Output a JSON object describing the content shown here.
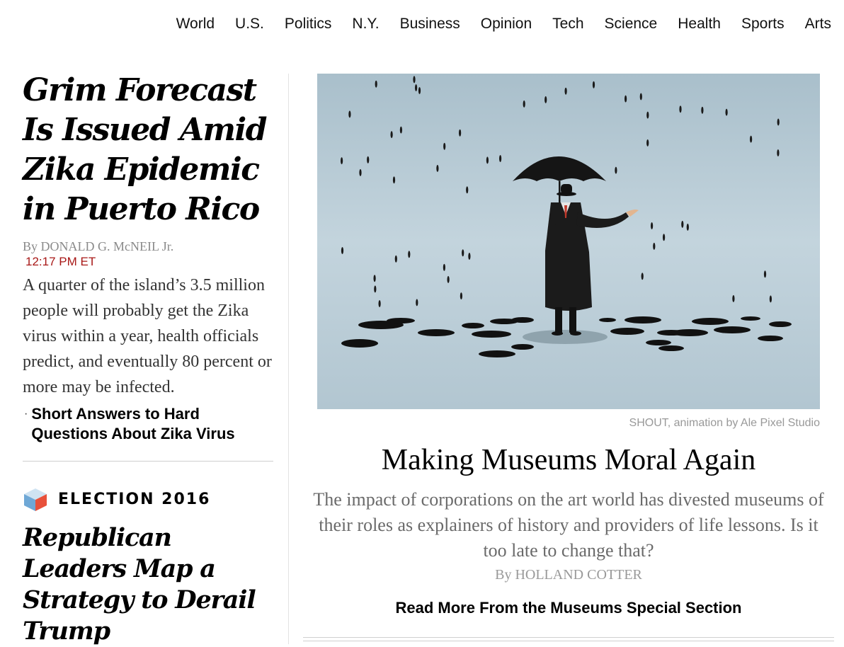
{
  "nav": {
    "items": [
      "World",
      "U.S.",
      "Politics",
      "N.Y.",
      "Business",
      "Opinion",
      "Tech",
      "Science",
      "Health",
      "Sports",
      "Arts"
    ]
  },
  "lead_story": {
    "headline": "Grim Forecast Is Issued Amid Zika Epidemic in Puerto Rico",
    "byline": "By DONALD G. McNEIL Jr.",
    "timestamp": "12:17 PM ET",
    "summary": "A quarter of the island’s 3.5 million people will probably get the Zika virus within a year, health officials predict, and eventually 80 percent or more may be infected.",
    "related_link": "Short Answers to Hard Questions About Zika Virus"
  },
  "election_story": {
    "kicker": "ELECTION 2016",
    "kicker_icon": "cube-icon",
    "headline": "Republican Leaders Map a Strategy to Derail Trump"
  },
  "feature_story": {
    "image_credit": "SHOUT, animation by Ale Pixel Studio",
    "headline": "Making Museums Moral Again",
    "summary": "The impact of corporations on the art world has divested museums of their roles as explainers of history and providers of life lessons. Is it too late to change that?",
    "byline": "By HOLLAND COTTER",
    "read_more": "Read More From the Museums Special Section"
  },
  "colors": {
    "timestamp": "#a81817",
    "byline": "#8a8a8a",
    "illustration_bg": "#b9ccd6",
    "cube_left": "#6fa8d6",
    "cube_right": "#e8513b"
  }
}
